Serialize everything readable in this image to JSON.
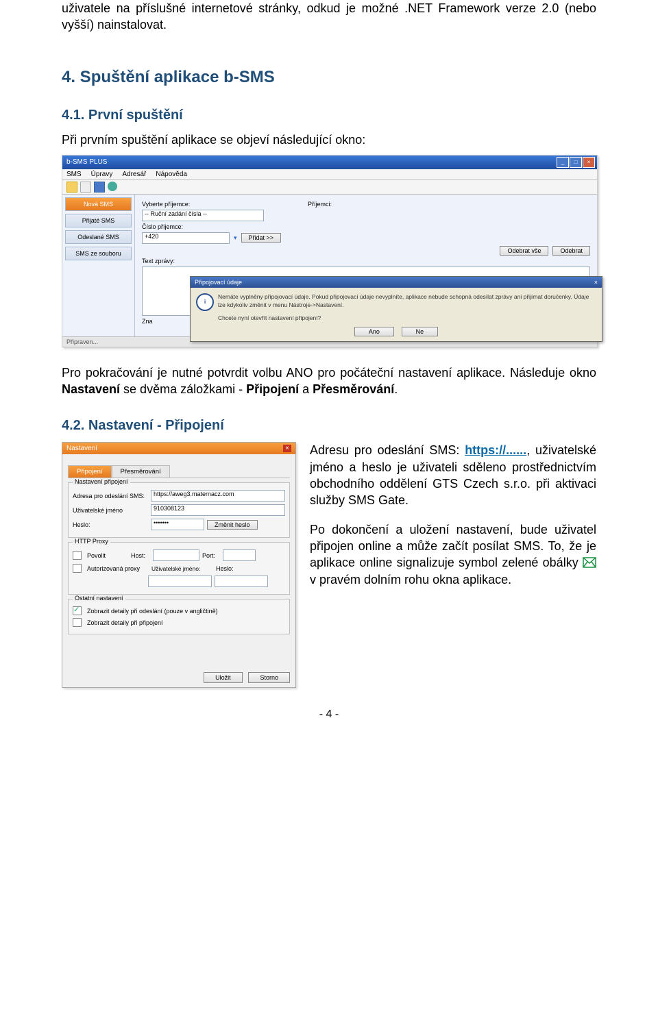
{
  "intro": "uživatele na příslušné internetové stránky, odkud je možné .NET Framework verze 2.0 (nebo vyšší) nainstalovat.",
  "h1": "4.   Spuštění aplikace b-SMS",
  "h2_41": "4.1. První spuštění",
  "lead41": "Při prvním spuštění aplikace se objeví následující okno:",
  "app": {
    "title": "b-SMS PLUS",
    "menus": [
      "SMS",
      "Úpravy",
      "Adresář",
      "Nápověda"
    ],
    "nav": [
      "Nová SMS",
      "Přijaté SMS",
      "Odeslané SMS",
      "SMS ze souboru"
    ],
    "lbl_vyberte": "Vyberte příjemce:",
    "sel_rucni": "-- Ruční zadání čísla --",
    "lbl_cislo": "Číslo příjemce:",
    "val_cislo": "+420",
    "btn_pridat": "Přidat >>",
    "lbl_prijemci": "Příjemci:",
    "btn_odebrat_vse": "Odebrat vše",
    "btn_odebrat": "Odebrat",
    "lbl_text": "Text zprávy:",
    "lbl_zna": "Zna",
    "status": "Připraven...",
    "dlg_title": "Připojovací údaje",
    "dlg_text1": "Nemáte vyplněny připojovací údaje. Pokud připojovací údaje nevyplníte, aplikace nebude schopná odesílat zprávy ani přijímat doručenky. Údaje lze kdykoliv změnit v menu Nástroje->Nastavení.",
    "dlg_text2": "Chcete nyní otevřít nastavení připojení?",
    "btn_ano": "Ano",
    "btn_ne": "Ne"
  },
  "para_after1_a": "Pro pokračování je nutné potvrdit volbu ANO pro počáteční nastavení aplikace. Následuje okno ",
  "para_after1_b": "Nastavení",
  "para_after1_c": " se dvěma záložkami - ",
  "para_after1_d": "Připojení",
  "para_after1_e": " a ",
  "para_after1_f": "Přesměrování",
  "para_after1_g": ".",
  "h2_42": "4.2. Nastavení - Připojení",
  "settings": {
    "title": "Nastavení",
    "tab1": "Připojení",
    "tab2": "Přesměrování",
    "grp1": "Nastavení připojení",
    "lbl_adresa": "Adresa pro odeslání SMS:",
    "val_adresa": "https://aweg3.maternacz.com",
    "lbl_user": "Uživatelské jméno",
    "val_user": "910308123",
    "lbl_heslo": "Heslo:",
    "val_heslo": "•••••••",
    "btn_zmenit": "Změnit heslo",
    "grp2": "HTTP Proxy",
    "chk_povolit": "Povolit",
    "lbl_host": "Host:",
    "lbl_port": "Port:",
    "chk_auth": "Autorizovaná proxy",
    "lbl_user2": "Uživatelské jméno:",
    "lbl_heslo2": "Heslo:",
    "grp3": "Ostatní nastavení",
    "chk_det1": "Zobrazit detaily při odeslání (pouze v angličtině)",
    "chk_det2": "Zobrazit detaily při připojení",
    "btn_ulozit": "Uložit",
    "btn_storno": "Storno"
  },
  "right": {
    "p1a": "Adresu pro odeslání SMS: ",
    "p1link": "https://......",
    "p1b": ", uživatelské jméno a heslo je uživateli sděleno prostřednictvím obchodního oddělení GTS Czech s.r.o. při aktivaci služby SMS Gate.",
    "p2a": "Po dokončení a uložení nastavení, bude uživatel připojen online a může začít posílat SMS. To, že je aplikace online signalizuje symbol zelené obálky ",
    "p2b": " v pravém dolním rohu okna aplikace."
  },
  "footer": "- 4 -"
}
